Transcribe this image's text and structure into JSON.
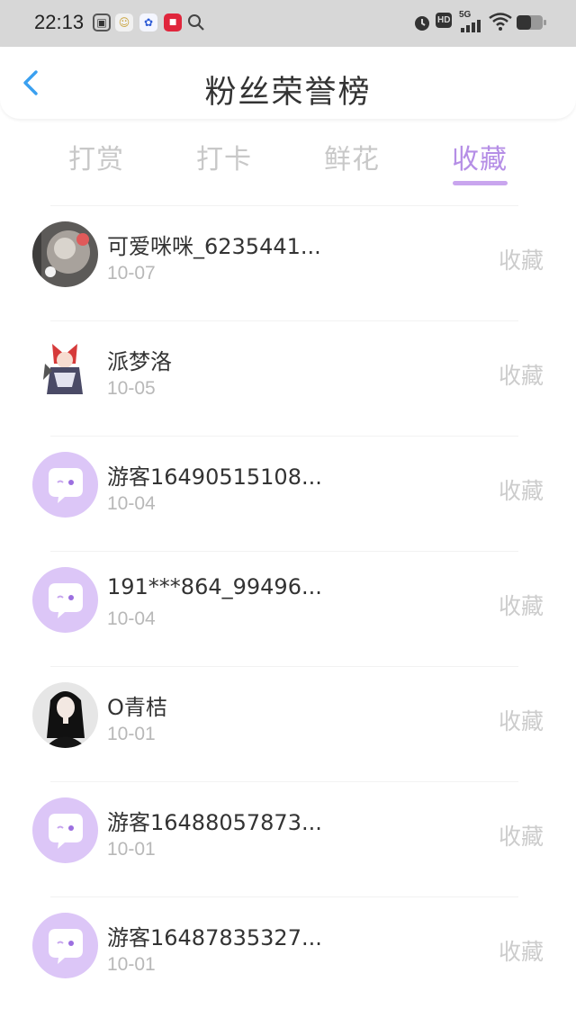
{
  "status_bar": {
    "time": "22:13",
    "network": "5G"
  },
  "header": {
    "title": "粉丝荣誉榜"
  },
  "tabs": [
    {
      "label": "打赏",
      "active": false
    },
    {
      "label": "打卡",
      "active": false
    },
    {
      "label": "鲜花",
      "active": false
    },
    {
      "label": "收藏",
      "active": true
    }
  ],
  "colors": {
    "accent": "#b58ee6",
    "default_avatar": "#dcc6f7"
  },
  "fans": [
    {
      "name": "可爱咪咪_6235441...",
      "date": "10-07",
      "action": "收藏",
      "avatar": "photo-cat"
    },
    {
      "name": "派梦洛",
      "date": "10-05",
      "action": "收藏",
      "avatar": "anime-redhair"
    },
    {
      "name": "游客16490515108...",
      "date": "10-04",
      "action": "收藏",
      "avatar": "default-chat"
    },
    {
      "name": "191***864_99496...",
      "date": "10-04",
      "action": "收藏",
      "avatar": "default-chat"
    },
    {
      "name": "O青桔",
      "date": "10-01",
      "action": "收藏",
      "avatar": "photo-girl"
    },
    {
      "name": "游客16488057873...",
      "date": "10-01",
      "action": "收藏",
      "avatar": "default-chat"
    },
    {
      "name": "游客16487835327...",
      "date": "10-01",
      "action": "收藏",
      "avatar": "default-chat"
    }
  ]
}
